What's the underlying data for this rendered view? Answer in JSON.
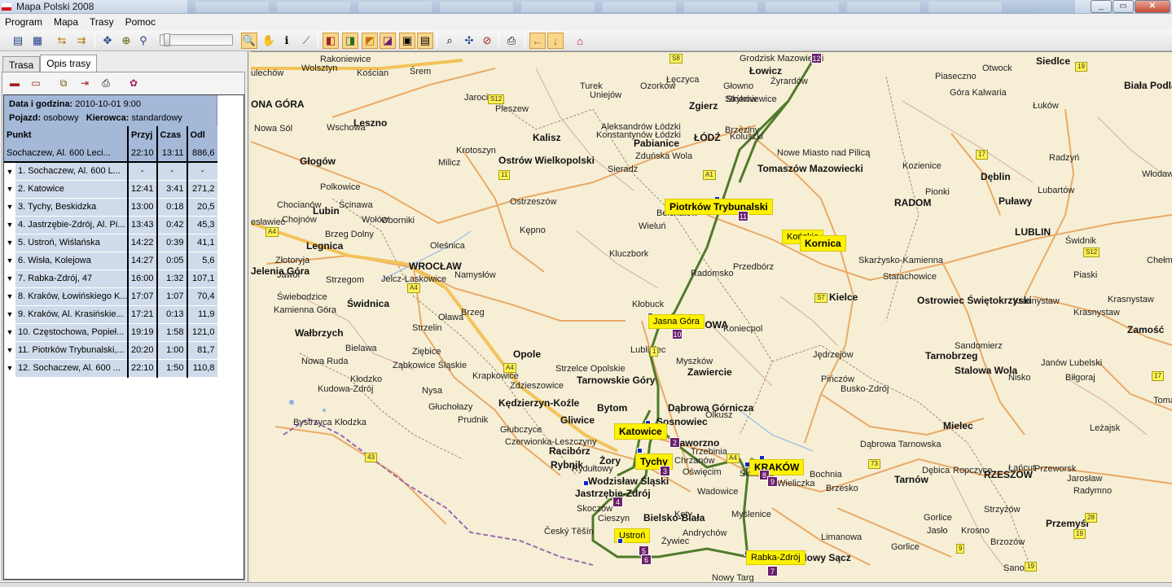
{
  "window": {
    "title": "Mapa Polski 2008"
  },
  "menu": [
    "Program",
    "Mapa",
    "Trasy",
    "Pomoc"
  ],
  "tabs": [
    "Trasa",
    "Opis trasy"
  ],
  "route_info": {
    "date_label": "Data i godzina:",
    "date_value": "2010-10-01 9:00",
    "vehicle_label": "Pojazd:",
    "vehicle_value": "osobowy",
    "driver_label": "Kierowca:",
    "driver_value": "standardowy"
  },
  "table": {
    "headers": [
      "Punkt",
      "Przyj",
      "Czas",
      "Odl"
    ],
    "summary": {
      "punkt": "Sochaczew, Al. 600 Leci...",
      "przyj": "22:10",
      "czas": "13:11",
      "odl": "886,6"
    },
    "rows": [
      {
        "punkt": "1. Sochaczew, Al. 600 L...",
        "przyj": "-",
        "czas": "-",
        "odl": "-"
      },
      {
        "punkt": "2. Katowice",
        "przyj": "12:41",
        "czas": "3:41",
        "odl": "271,2"
      },
      {
        "punkt": "3. Tychy, Beskidzka",
        "przyj": "13:00",
        "czas": "0:18",
        "odl": "20,5"
      },
      {
        "punkt": "4. Jastrzębie-Zdrój, Al. Pi...",
        "przyj": "13:43",
        "czas": "0:42",
        "odl": "45,3"
      },
      {
        "punkt": "5. Ustroń, Wiślańska",
        "przyj": "14:22",
        "czas": "0:39",
        "odl": "41,1"
      },
      {
        "punkt": "6. Wisła, Kolejowa",
        "przyj": "14:27",
        "czas": "0:05",
        "odl": "5,6"
      },
      {
        "punkt": "7. Rabka-Zdrój, 47",
        "przyj": "16:00",
        "czas": "1:32",
        "odl": "107,1"
      },
      {
        "punkt": "8. Kraków, Łowińskiego K...",
        "przyj": "17:07",
        "czas": "1:07",
        "odl": "70,4"
      },
      {
        "punkt": "9. Kraków, Al. Krasińskie...",
        "przyj": "17:21",
        "czas": "0:13",
        "odl": "11,9"
      },
      {
        "punkt": "10. Częstochowa, Popieł...",
        "przyj": "19:19",
        "czas": "1:58",
        "odl": "121,0"
      },
      {
        "punkt": "11. Piotrków Trybunalski,...",
        "przyj": "20:20",
        "czas": "1:00",
        "odl": "81,7"
      },
      {
        "punkt": "12. Sochaczew, Al. 600 ...",
        "przyj": "22:10",
        "czas": "1:50",
        "odl": "110,8"
      }
    ]
  },
  "map": {
    "big_cities": [
      "OSTRÓW WIELKOPOLSKI",
      "ŁÓDŹ",
      "WROCŁAW",
      "RADOM",
      "LUBLIN",
      "KRAKÓW",
      "RZESZÓW",
      "OPOLE",
      "KATOWICE"
    ],
    "route_labels": {
      "piotrkow": "Piotrków Trybunalski",
      "konskie": "Końskie",
      "kornica": "Kornica",
      "jasna_gora": "Jasna Góra",
      "katowice": "Katowice",
      "tychy": "Tychy",
      "krakow": "KRAKÓW",
      "ustron": "Ustroń",
      "rabka": "Rabka-Zdrój"
    },
    "stop_numbers": [
      "2",
      "3",
      "4",
      "5",
      "6",
      "7",
      "8",
      "9",
      "10",
      "11",
      "12"
    ]
  },
  "colors": {
    "route": "#4f7a2a",
    "label": "#fff200",
    "stop": "#6b1f6b",
    "header": "#a4b9d8"
  }
}
